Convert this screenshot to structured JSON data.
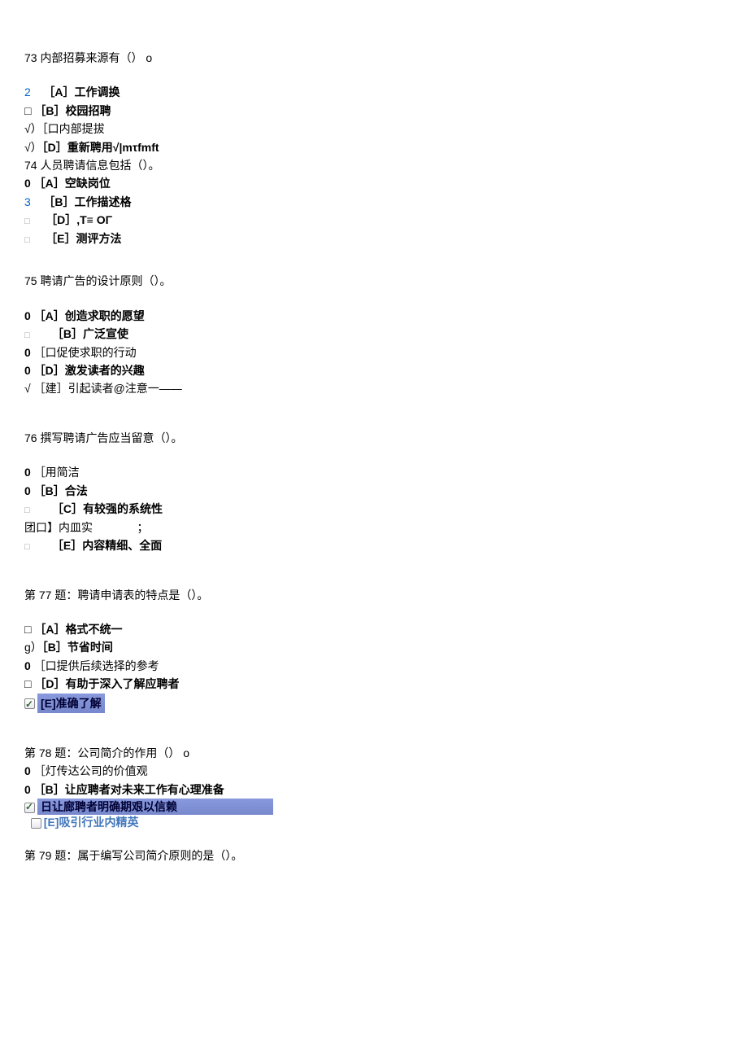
{
  "q73": {
    "title": "73 内部招募来源有（） o",
    "a_prefix": "2",
    "a": "［A］工作调换",
    "b_prefix": "□",
    "b": "［B］校园招聘",
    "c_prefix": "√）",
    "c": "［口内部提拔",
    "d_prefix": "√）",
    "d": "［D］重新聘用√|mτfmft"
  },
  "q74": {
    "title": "74 人员聘请信息包括（）。",
    "a_prefix": "0",
    "a": "［A］空缺岗位",
    "b_prefix": "3",
    "b": "［B］工作描述格",
    "d_prefix": "□",
    "d": "［D］,T≡ OΓ",
    "e_prefix": "□",
    "e": "［E］测评方法"
  },
  "q75": {
    "title": "75 聘请广告的设计原则（）。",
    "a_prefix": "0",
    "a": "［A］创造求职的愿望",
    "b_prefix": "□",
    "b": "［B］广泛宣使",
    "c_prefix": "0",
    "c": "［口促使求职的行动",
    "d_prefix": "0",
    "d": "［D］激发读者的兴趣",
    "e_prefix": "√",
    "e": "［建］引起读者@注意一——"
  },
  "q76": {
    "title": "76 撰写聘请广告应当留意（）。",
    "a_prefix": "0",
    "a": "［用简洁",
    "b_prefix": "0",
    "b": "［B］合法",
    "c_prefix": "□",
    "c": "［C］有较强的系统性",
    "d_prefix": "团",
    "d_mid": "口】内皿实",
    "d_suffix": "；",
    "e_prefix": "□",
    "e": "［E］内容精细、全面"
  },
  "q77": {
    "title": "第 77 题：聘请申请表的特点是（）。",
    "a_prefix": "□",
    "a": "［A］格式不统一",
    "b_prefix": "g）",
    "b": "［B］节省时间",
    "c_prefix": "0",
    "c": "［口提供后续选择的参考",
    "d_prefix": "□",
    "d": "［D］有助于深入了解应聘者",
    "e": "[E]准确了解"
  },
  "q78": {
    "title": "第 78 题：公司简介的作用（） o",
    "a_prefix": "0",
    "a": "［灯传达公司的价值观",
    "b_prefix": "0",
    "b": "［B］让应聘者对未来工作有心理准备",
    "cd": "日让廊聘者明确期艰以信赖",
    "e": "[E]吸引行业内精英"
  },
  "q79": {
    "title": "第 79 题：属于编写公司简介原则的是（）。"
  }
}
